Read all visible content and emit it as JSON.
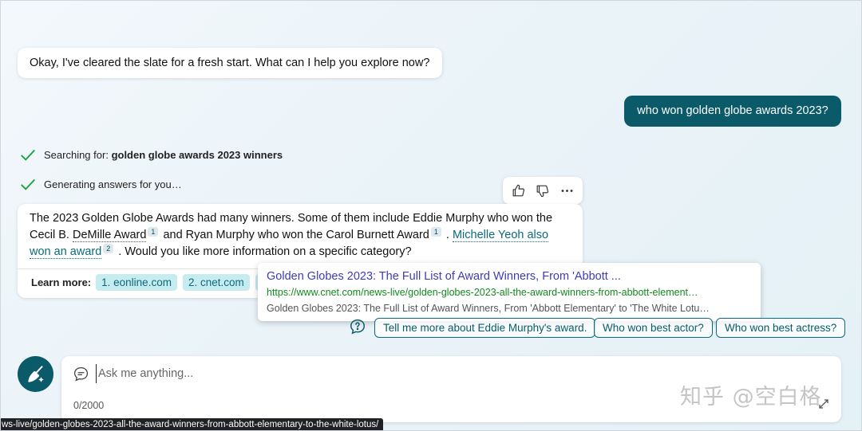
{
  "chat": {
    "bot_greeting": "Okay, I've cleared the slate for a fresh start. What can I help you explore now?",
    "user_message": "who won golden globe awards 2023?"
  },
  "status": {
    "searching_prefix": "Searching for: ",
    "searching_query": "golden globe awards 2023 winners",
    "generating": "Generating answers for you…"
  },
  "answer": {
    "part1": "The 2023 Golden Globe Awards had many winners. Some of them include Eddie Murphy who won the Cecil B. ",
    "link1": "DeMille Award",
    "cite1": "1",
    "part2": " and Ryan Murphy who won the Carol Burnett Award",
    "cite2": "1",
    "part3": " . ",
    "link2": "Michelle Yeoh also won an award",
    "cite3": "2",
    "part4": " . Would you like more information on a specific category?"
  },
  "learn_more": {
    "label": "Learn more:",
    "sources": [
      "1. eonline.com",
      "2. cnet.com",
      "3."
    ]
  },
  "popup": {
    "title": "Golden Globes 2023: The Full List of Award Winners, From 'Abbott ...",
    "url": "https://www.cnet.com/news-live/golden-globes-2023-all-the-award-winners-from-abbott-element…",
    "description": "Golden Globes 2023: The Full List of Award Winners, From 'Abbott Elementary' to 'The White Lotu…"
  },
  "suggestions": [
    "Tell me more about Eddie Murphy's award.",
    "Who won best actor?",
    "Who won best actress?"
  ],
  "input": {
    "placeholder": "Ask me anything...",
    "counter": "0/2000"
  },
  "watermark": "知乎 @空白格",
  "status_bar_url": "ws-live/golden-globes-2023-all-the-award-winners-from-abbott-elementary-to-the-white-lotus/",
  "colors": {
    "accent": "#0b5a69",
    "link": "#0b6a7c",
    "chip_bg": "#c7ecf0",
    "check": "#1aa33a"
  },
  "icons": {
    "check": "check-icon",
    "thumbs_up": "thumbs-up-icon",
    "thumbs_down": "thumbs-down-icon",
    "more": "more-icon",
    "new_topic": "broom-icon",
    "chat": "chat-bubble-icon",
    "suggestion": "question-bubble-icon"
  }
}
